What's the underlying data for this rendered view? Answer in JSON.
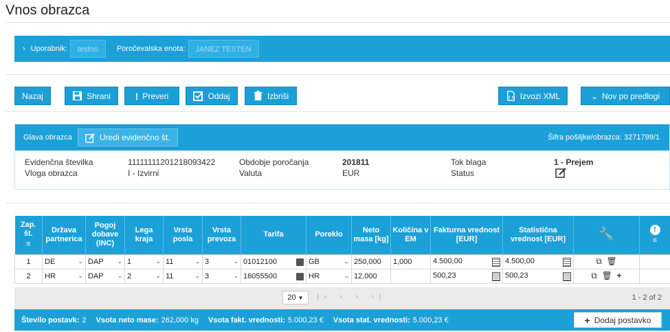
{
  "page": {
    "title": "Vnos obrazca"
  },
  "user_bar": {
    "user_label": "Uporabnik:",
    "user_value": "testno",
    "unit_label": "Poročevalska enota:",
    "unit_value": "JANEZ TESTEN"
  },
  "toolbar": {
    "back": "Nazaj",
    "save": "Shrani",
    "check": "Preveri",
    "submit": "Oddaj",
    "delete": "Izbriši",
    "export_xml": "Izvozi XML",
    "new_template": "Nov po predlogi"
  },
  "header": {
    "title": "Glava obrazca",
    "edit_button": "Uredi evidenčno št.",
    "code": "Šifra pošiljke/obrazca: 3271799/1",
    "fields": {
      "evid_label": "Evidenčna številka",
      "evid_value": "11111111201218093422",
      "role_label": "Vloga obrazca",
      "role_value": "I - Izvirni",
      "period_label": "Obdobje poročanja",
      "period_value": "201811",
      "currency_label": "Valuta",
      "currency_value": "EUR",
      "flow_label": "Tok blaga",
      "flow_value": "1 - Prejem",
      "status_label": "Status"
    }
  },
  "table": {
    "headers": {
      "seq": "Zap. št.",
      "country": "Država partnerica",
      "delivery": "Pogoj dobave (INC)",
      "location": "Lega kraja",
      "transaction": "Vrsta posla",
      "transport": "Vrsta prevoza",
      "tariff": "Tarifa",
      "origin": "Poreklo",
      "mass": "Neto masa [kg]",
      "qty": "Količina v EM",
      "invoice": "Fakturna vrednost [EUR]",
      "stat": "Statistična vrednost [EUR]"
    },
    "rows": [
      {
        "seq": "1",
        "country": "DE",
        "delivery": "DAP",
        "location": "1",
        "transaction": "11",
        "transport": "3",
        "tariff": "01012100",
        "origin": "GB",
        "mass": "250,000",
        "qty": "1,000",
        "invoice": "4.500,00",
        "stat": "4.500,00"
      },
      {
        "seq": "2",
        "country": "HR",
        "delivery": "DAP",
        "location": "2",
        "transaction": "11",
        "transport": "3",
        "tariff": "16055500",
        "origin": "HR",
        "mass": "12,000",
        "qty": "",
        "invoice": "500,23",
        "stat": "500,23"
      }
    ]
  },
  "pager": {
    "page_size": "20",
    "nav": "|‹ ‹ › ›|",
    "count": "1 - 2 of 2"
  },
  "footer": {
    "items_label": "Število postavk:",
    "items_value": "2",
    "mass_label": "Vsota neto mase:",
    "mass_value": "262,000 kg",
    "inv_label": "Vsota fakt. vrednosti:",
    "inv_value": "5.000,23 €",
    "stat_label": "Vsota stat. vrednosti:",
    "stat_value": "5.000,23 €",
    "add_button": "Dodaj postavko"
  },
  "colors": {
    "accent": "#1ca0d8",
    "pager_bg": "#eaeaea"
  }
}
